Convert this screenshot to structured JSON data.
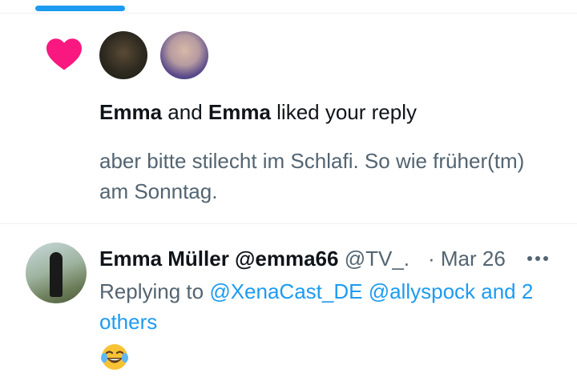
{
  "tabs": {
    "active_indicator_color": "#1d9bf0"
  },
  "notification": {
    "icon": "heart-icon",
    "icon_color": "#f91880",
    "avatars": [
      "avatar-user-1",
      "avatar-user-2"
    ],
    "liker_1": "Emma",
    "connector": " and ",
    "liker_2": "Emma",
    "action": " liked your reply",
    "reply_text": "aber bitte stilecht im Schlafi. So wie früher(tm) am Sonntag."
  },
  "reply": {
    "display_name": "Emma Müller @emma66",
    "handle": " @TV_.",
    "date": "· Mar 26",
    "more_icon": "more-options-icon",
    "replying_prefix": "Replying to ",
    "mention_1": "@XenaCast_DE",
    "mention_2": "@allyspock",
    "mention_3": "and 2 others",
    "body_emoji": "face-with-tears-of-joy"
  },
  "colors": {
    "link": "#1d9bf0",
    "secondary_text": "#536471",
    "primary_text": "#0f1419"
  }
}
